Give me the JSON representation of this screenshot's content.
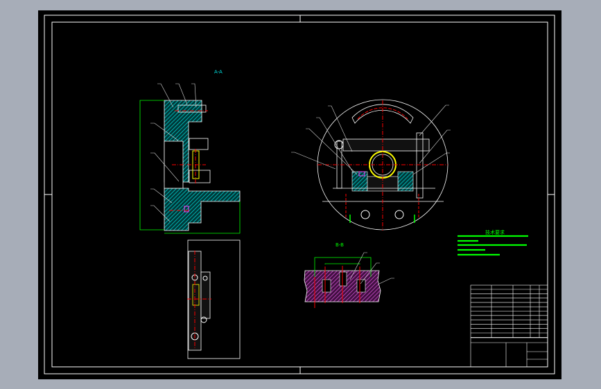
{
  "drawing": {
    "section_a_label": "A-A",
    "section_b_label": "B-B",
    "tech_requirements_title": "技术要求"
  },
  "colors": {
    "background": "#000000",
    "outline": "#ffffff",
    "hatch_a": "#00c8c8",
    "hatch_b": "#d040d0",
    "centerline": "#ff0000",
    "dimension": "#00ff00",
    "highlight": "#ffff00",
    "window": "#a7adb8"
  }
}
